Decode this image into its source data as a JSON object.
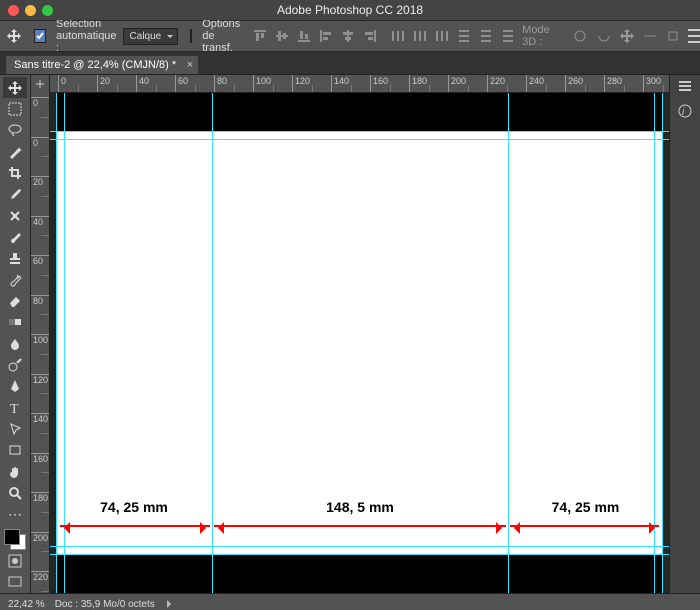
{
  "title": "Adobe Photoshop CC 2018",
  "options": {
    "auto_select_label": "Sélection automatique :",
    "auto_select_checked": true,
    "layer_dropdown": "Calque",
    "transform_label": "Options de transf.",
    "mode3d_label": "Mode 3D :"
  },
  "document": {
    "tab_label": "Sans titre-2 @ 22,4% (CMJN/8) *"
  },
  "rulers": {
    "h": [
      "0",
      "20",
      "40",
      "60",
      "80",
      "100",
      "120",
      "140",
      "160",
      "180",
      "200",
      "220",
      "240",
      "260",
      "280",
      "300"
    ],
    "v": [
      "0",
      "0",
      "20",
      "40",
      "60",
      "80",
      "100",
      "120",
      "140",
      "160",
      "180",
      "200",
      "220"
    ]
  },
  "tools": [
    {
      "name": "move",
      "selected": true,
      "svg": "move"
    },
    {
      "name": "marquee",
      "svg": "marquee"
    },
    {
      "name": "lasso",
      "svg": "lasso"
    },
    {
      "name": "wand",
      "svg": "wand"
    },
    {
      "name": "crop",
      "svg": "crop"
    },
    {
      "name": "eyedropper",
      "svg": "eyedropper"
    },
    {
      "name": "heal",
      "svg": "heal"
    },
    {
      "name": "brush",
      "svg": "brush"
    },
    {
      "name": "stamp",
      "svg": "stamp"
    },
    {
      "name": "history-brush",
      "svg": "hbrush"
    },
    {
      "name": "eraser",
      "svg": "eraser"
    },
    {
      "name": "gradient",
      "svg": "gradient"
    },
    {
      "name": "blur",
      "svg": "blur"
    },
    {
      "name": "dodge",
      "svg": "dodge"
    },
    {
      "name": "pen",
      "svg": "pen"
    },
    {
      "name": "type",
      "svg": "type"
    },
    {
      "name": "path-select",
      "svg": "pathsel"
    },
    {
      "name": "rectangle",
      "svg": "rect"
    },
    {
      "name": "hand",
      "svg": "hand"
    },
    {
      "name": "zoom",
      "svg": "zoom"
    }
  ],
  "dimensions": {
    "left": {
      "label": "74, 25 mm"
    },
    "mid": {
      "label": "148, 5 mm"
    },
    "right": {
      "label": "74, 25 mm"
    }
  },
  "status": {
    "zoom": "22,42 %",
    "doc": "Doc : 35,9 Mo/0 octets"
  }
}
